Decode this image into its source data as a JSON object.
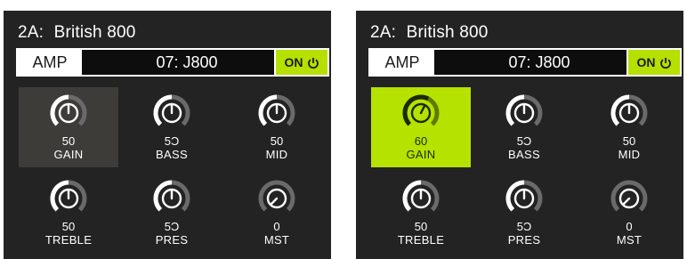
{
  "colors": {
    "panel_bg": "#232323",
    "accent_green": "#b5e000",
    "selection_grey": "#3e3c39",
    "text": "#ffffff"
  },
  "panels": [
    {
      "title_slot": "2A:",
      "title_name": "British 800",
      "amp_label": "AMP",
      "model": "07: J800",
      "on_label": "ON",
      "on_icon": "power-icon",
      "knobs": [
        {
          "label": "GAIN",
          "value": "50",
          "level": 0.5,
          "icon": "knob-icon",
          "selected": "grey"
        },
        {
          "label": "BASS",
          "value": "5Ͻ",
          "level": 0.5,
          "icon": "knob-icon",
          "selected": "none"
        },
        {
          "label": "MID",
          "value": "50",
          "level": 0.5,
          "icon": "knob-icon",
          "selected": "none"
        },
        {
          "label": "TREBLE",
          "value": "50",
          "level": 0.5,
          "icon": "knob-icon",
          "selected": "none"
        },
        {
          "label": "PRES",
          "value": "5Ͻ",
          "level": 0.5,
          "icon": "knob-icon",
          "selected": "none"
        },
        {
          "label": "MST",
          "value": "0",
          "level": 0,
          "icon": "knob-icon",
          "selected": "none"
        }
      ]
    },
    {
      "title_slot": "2A:",
      "title_name": "British 800",
      "amp_label": "AMP",
      "model": "07: J800",
      "on_label": "ON",
      "on_icon": "power-icon",
      "knobs": [
        {
          "label": "GAIN",
          "value": "60",
          "level": 0.6,
          "icon": "knob-icon",
          "selected": "green"
        },
        {
          "label": "BASS",
          "value": "5Ͻ",
          "level": 0.5,
          "icon": "knob-icon",
          "selected": "none"
        },
        {
          "label": "MID",
          "value": "50",
          "level": 0.5,
          "icon": "knob-icon",
          "selected": "none"
        },
        {
          "label": "TREBLE",
          "value": "50",
          "level": 0.5,
          "icon": "knob-icon",
          "selected": "none"
        },
        {
          "label": "PRES",
          "value": "5Ͻ",
          "level": 0.5,
          "icon": "knob-icon",
          "selected": "none"
        },
        {
          "label": "MST",
          "value": "0",
          "level": 0,
          "icon": "knob-icon",
          "selected": "none"
        }
      ]
    }
  ]
}
